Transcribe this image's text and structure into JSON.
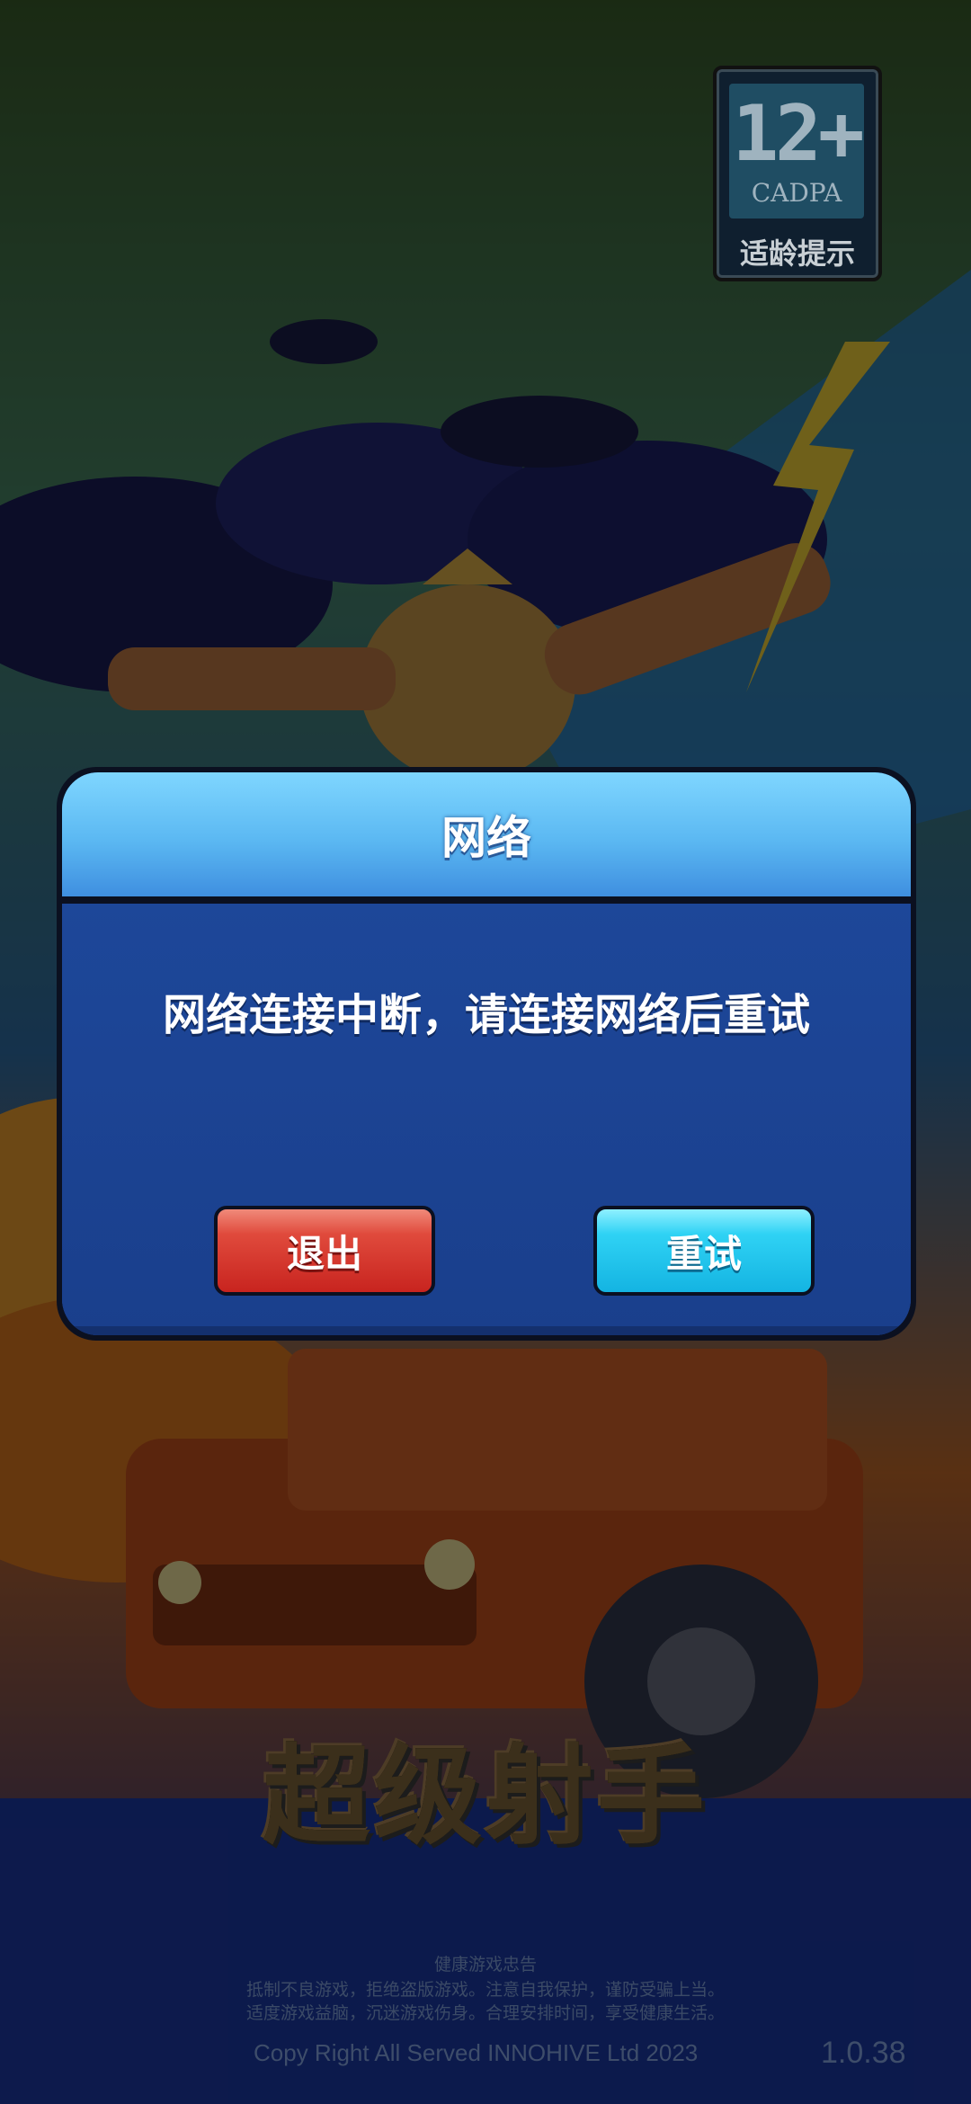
{
  "age_rating": {
    "number": "12+",
    "org": "CADPA",
    "hint": "适龄提示"
  },
  "dialog": {
    "title": "网络",
    "message": "网络连接中断，请连接网络后重试",
    "exit_label": "退出",
    "retry_label": "重试"
  },
  "game_logo": "超级射手",
  "footer": {
    "health_title": "健康游戏忠告",
    "health_line_1": "抵制不良游戏，拒绝盗版游戏。注意自我保护，谨防受骗上当。",
    "health_line_2": "适度游戏益脑，沉迷游戏伤身。合理安排时间，享受健康生活。",
    "copyright": "Copy Right All Served INNOHIVE Ltd 2023",
    "version": "1.0.38"
  },
  "colors": {
    "dialog_header": "#5bb8f2",
    "dialog_body": "#1c4597",
    "exit_button": "#d8322a",
    "retry_button": "#22c8ee"
  }
}
